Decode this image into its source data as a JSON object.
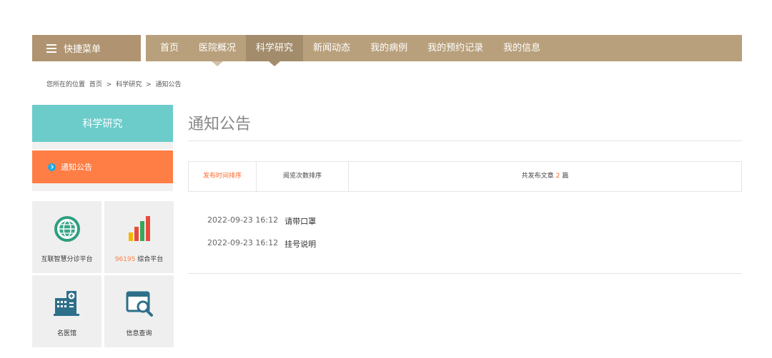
{
  "nav": {
    "quick_menu": "快捷菜单",
    "items": [
      {
        "label": "首页"
      },
      {
        "label": "医院概况"
      },
      {
        "label": "科学研究"
      },
      {
        "label": "新闻动态"
      },
      {
        "label": "我的病例"
      },
      {
        "label": "我的预约记录"
      },
      {
        "label": "我的信息"
      }
    ],
    "active_index": 2
  },
  "breadcrumb": {
    "prefix": "您所在的位置",
    "home": "首页",
    "sep1": ">",
    "section": "科学研究",
    "sep2": ">",
    "current": "通知公告"
  },
  "sidebar": {
    "heading": "科学研究",
    "item": "通知公告",
    "tiles": [
      {
        "label": "互联智慧分诊平台",
        "icon": "globe-icon"
      },
      {
        "num": "96195",
        "label": " 综合平台",
        "icon": "bar-chart-icon"
      },
      {
        "label": "名医馆",
        "icon": "hospital-icon"
      },
      {
        "label": "信息查询",
        "icon": "search-window-icon"
      }
    ]
  },
  "main": {
    "title": "通知公告",
    "sort_time": "发布时间排序",
    "sort_views": "阅览次数排序",
    "count_prefix": "共发布文章",
    "count_value": "2",
    "count_suffix": "篇",
    "articles": [
      {
        "date": "2022-09-23 16:12",
        "title": "请带口罩"
      },
      {
        "date": "2022-09-23 16:12",
        "title": "挂号说明"
      }
    ]
  },
  "colors": {
    "nav": "#b9a07c",
    "nav_active": "#a38c6c",
    "sidebar_head": "#6cccca",
    "sidebar_item": "#ff7e45",
    "accent": "#ff6a2a"
  }
}
